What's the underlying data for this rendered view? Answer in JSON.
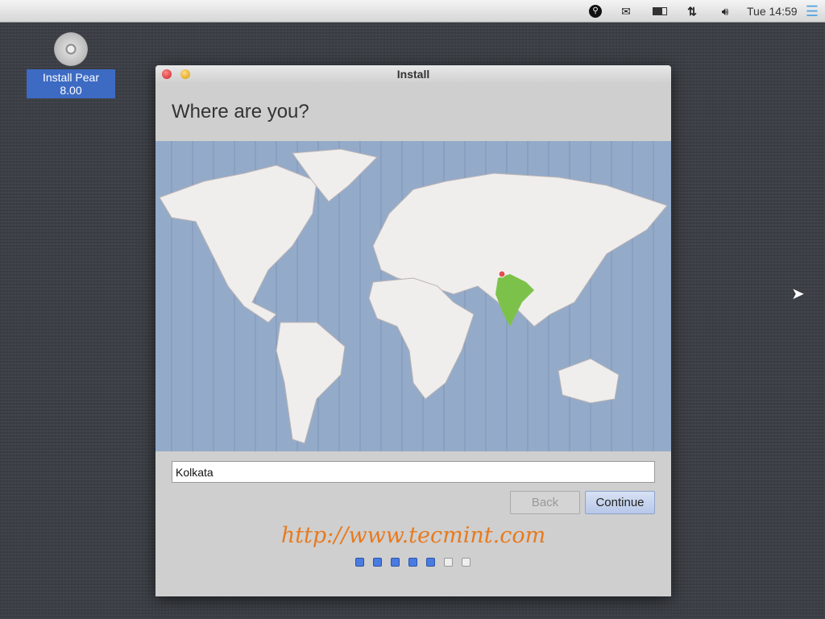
{
  "topbar": {
    "clock": "Tue 14:59",
    "icons": [
      "apple-icon",
      "search-icon",
      "mail-icon",
      "battery-icon",
      "network-icon",
      "volume-icon",
      "menu-icon"
    ]
  },
  "desktop": {
    "icon_label": "Install Pear 8.00"
  },
  "window": {
    "title": "Install",
    "heading": "Where are you?",
    "location_value": "Kolkata",
    "back_label": "Back",
    "continue_label": "Continue",
    "watermark": "http://www.tecmint.com",
    "progress": {
      "completed": 5,
      "total": 7
    }
  },
  "colors": {
    "ocean": "#94aac9",
    "land": "#f0eded",
    "selected": "#7cc24a",
    "accent": "#4a7be0"
  }
}
